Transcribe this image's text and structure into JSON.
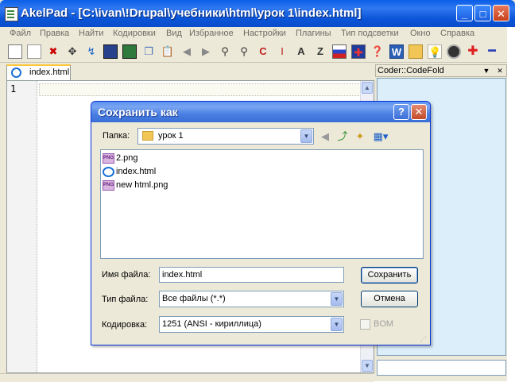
{
  "window": {
    "title": "AkelPad - [C:\\ivan\\!Drupal\\учебники\\html\\урок 1\\index.html]",
    "caption_buttons": {
      "minimize": "_",
      "maximize": "□",
      "close": "✕"
    }
  },
  "menu": [
    "Файл",
    "Правка",
    "Найти",
    "Кодировки",
    "Вид",
    "Избранное",
    "Настройки",
    "Плагины",
    "Тип подсветки",
    "Окно",
    "Справка"
  ],
  "toolbar_icons": [
    "new-icon",
    "copy-doc-icon",
    "close-doc-icon",
    "move-icon",
    "goto-icon",
    "save-icon",
    "save-all-icon",
    "copy-icon",
    "paste-icon",
    "back-icon",
    "forward-icon",
    "find-icon",
    "replace-icon",
    "color-icon",
    "cursor-icon",
    "case-icon",
    "sort-icon",
    "flag-ru-icon",
    "flag-uk-icon",
    "help-icon",
    "word-icon",
    "folder-icon",
    "bulb-icon",
    "speaker-icon",
    "plus-icon",
    "minus-icon"
  ],
  "tabs": [
    {
      "label": "index.html",
      "icon": "ie-icon"
    }
  ],
  "editor": {
    "line_numbers": [
      "1"
    ]
  },
  "panel": {
    "title": "Coder::CodeFold"
  },
  "dialog": {
    "title": "Сохранить как",
    "caption_buttons": {
      "help": "?",
      "close": "✕"
    },
    "look_in_label": "Папка:",
    "look_in_value": "урок 1",
    "files": [
      {
        "name": "2.png",
        "icon": "png-file-icon"
      },
      {
        "name": "index.html",
        "icon": "html-file-icon"
      },
      {
        "name": "new html.png",
        "icon": "png-file-icon"
      }
    ],
    "filename_label": "Имя файла:",
    "filename_value": "index.html",
    "filetype_label": "Тип файла:",
    "filetype_value": "Все файлы (*.*)",
    "encoding_label": "Кодировка:",
    "encoding_value": "1251  (ANSI - кириллица)",
    "save_button": "Сохранить",
    "cancel_button": "Отмена",
    "bom_label": "BOM",
    "bom_checked": false
  },
  "colors": {
    "title_blue": "#0a5ee8",
    "panel_bg": "#dbeefa",
    "dialog_bg": "#ece9d8"
  }
}
